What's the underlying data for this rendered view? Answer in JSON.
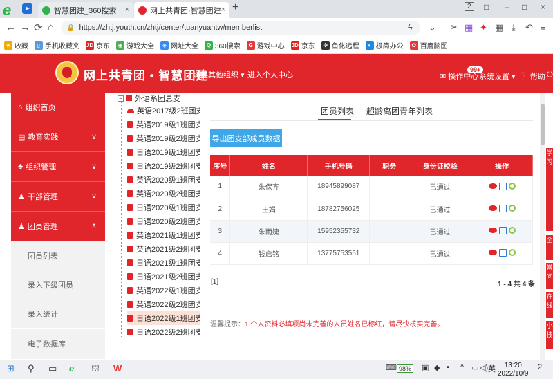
{
  "browser": {
    "tabs": [
      {
        "title": "智慧团建_360搜索",
        "close": "×"
      },
      {
        "title": "网上共青团·智慧团建",
        "close": "×"
      }
    ],
    "new_tab": "+",
    "url": "https://zhtj.youth.cn/zhtj/center/tuanyuantw/memberlist",
    "window_controls": [
      "2",
      "□",
      "–",
      "□",
      "×"
    ],
    "bookmarks": [
      {
        "label": "收藏",
        "color": "#f2a900"
      },
      {
        "label": "手机收藏夹",
        "color": "#5b9bd5"
      },
      {
        "label": "京东",
        "color": "#e1251b"
      },
      {
        "label": "游戏大全",
        "color": "#4caf50"
      },
      {
        "label": "网址大全",
        "color": "#3b8beb"
      },
      {
        "label": "360搜索",
        "color": "#2fb34a"
      },
      {
        "label": "游戏中心",
        "color": "#e53935"
      },
      {
        "label": "京东",
        "color": "#e1251b"
      },
      {
        "label": "鱼化远程",
        "color": "#333333"
      },
      {
        "label": "极简办公",
        "color": "#1e88e5"
      },
      {
        "label": "百度脑图",
        "color": "#e53935"
      }
    ]
  },
  "header": {
    "site_name": "网上共青团 • 智慧团建",
    "switch_org": "切换其他组织 ▾",
    "personal_center": "进入个人中心",
    "op_center": "✉ 操作中心",
    "badge": "99+",
    "system_settings": "系统设置 ▾",
    "help": "❓ 帮助",
    "power": "⏻"
  },
  "sidebar": {
    "items": [
      {
        "label": "组织首页",
        "icon": "home-icon",
        "chev": ""
      },
      {
        "label": "教育实践",
        "icon": "book-icon",
        "chev": "∨"
      },
      {
        "label": "组织管理",
        "icon": "org-icon",
        "chev": "∨"
      },
      {
        "label": "干部管理",
        "icon": "users-icon",
        "chev": "∨"
      },
      {
        "label": "团员管理",
        "icon": "users-icon",
        "chev": "∧"
      }
    ],
    "subitems": [
      "团员列表",
      "录入下级团员",
      "录入统计",
      "电子数据库"
    ]
  },
  "tree": {
    "root": "外语系团总支",
    "nodes": [
      "英语2017级2班团支部",
      "英语2019级1班团支部",
      "英语2019级2班团支部",
      "日语2019级1班团支部",
      "日语2019级2班团支部",
      "英语2020级1班团支部",
      "英语2020级2班团支部",
      "日语2020级1班团支部",
      "日语2020级2班团支部",
      "英语2021级1班团支部",
      "英语2021级2班团支部",
      "日语2021级1班团支部",
      "日语2021级2班团支部",
      "英语2022级1班团支部",
      "英语2022级2班团支部",
      "日语2022级1班团支部",
      "日语2022级2班团支部"
    ]
  },
  "main": {
    "tab_members": "团员列表",
    "tab_overage": "超龄离团青年列表",
    "export_button": "导出团支部成员数据",
    "columns": [
      "序号",
      "姓名",
      "手机号码",
      "职务",
      "身份证校验",
      "操作"
    ],
    "rows": [
      {
        "no": "1",
        "name": "朱保齐",
        "phone": "18945899087",
        "role": "",
        "id_check": "已通过"
      },
      {
        "no": "2",
        "name": "王娟",
        "phone": "18782756025",
        "role": "",
        "id_check": "已通过"
      },
      {
        "no": "3",
        "name": "朱雨婕",
        "phone": "15952355732",
        "role": "",
        "id_check": "已通过"
      },
      {
        "no": "4",
        "name": "钱启铭",
        "phone": "13775753551",
        "role": "",
        "id_check": "已通过"
      }
    ],
    "pager_left": "[1]",
    "pager_right": "1 - 4  共 4 条",
    "hint_label": "温馨提示：",
    "hint_text": "1.个人资料必填项尚未完善的人员姓名已标红，请尽快核实完善。"
  },
  "right_strip": [
    "学习",
    "全",
    "常问",
    "在线",
    "小技"
  ],
  "taskbar": {
    "battery": "98%",
    "ime": "英",
    "time": "13:20",
    "date": "2022/10/9",
    "notif": "2"
  }
}
